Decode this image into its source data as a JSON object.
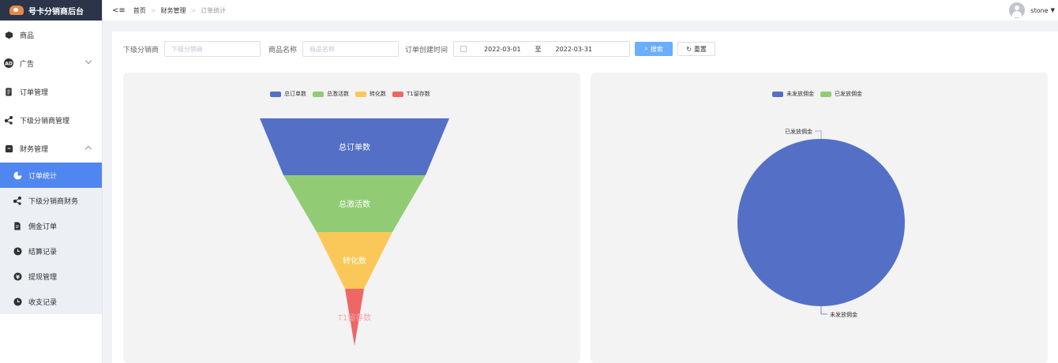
{
  "app": {
    "title": "号卡分销商后台"
  },
  "sidebar": {
    "items": [
      {
        "label": "商品",
        "icon": "box-icon"
      },
      {
        "label": "广告",
        "icon": "ad-icon"
      },
      {
        "label": "订单管理",
        "icon": "document-icon"
      },
      {
        "label": "下级分销商管理",
        "icon": "share-icon"
      },
      {
        "label": "财务管理",
        "icon": "wallet-icon"
      }
    ],
    "finance_sub": [
      {
        "label": "订单统计",
        "icon": "pie-icon"
      },
      {
        "label": "下级分销商财务",
        "icon": "share-icon"
      },
      {
        "label": "佣金订单",
        "icon": "file-icon"
      },
      {
        "label": "结算记录",
        "icon": "clock-icon"
      },
      {
        "label": "提现管理",
        "icon": "yen-icon"
      },
      {
        "label": "收支记录",
        "icon": "clock-icon"
      }
    ]
  },
  "breadcrumb": {
    "home": "首页",
    "section": "财务管理",
    "page": "订单统计"
  },
  "user": {
    "name": "stone"
  },
  "filters": {
    "distributor_label": "下级分销商",
    "distributor_placeholder": "下级分销商",
    "product_label": "商品名称",
    "product_placeholder": "商品名称",
    "time_label": "订单创建时间",
    "start_date": "2022-03-01",
    "range_sep": "至",
    "end_date": "2022-03-31",
    "search_button": "搜索",
    "reset_button": "重置"
  },
  "colors": {
    "blue": "#5470c6",
    "green": "#91cc75",
    "yellow": "#fac858",
    "red": "#ee6666",
    "active": "#4f86f0"
  },
  "chart_data": [
    {
      "type": "funnel",
      "legend": [
        "总订单数",
        "总激活数",
        "转化数",
        "T1留存数"
      ],
      "categories": [
        "总订单数",
        "总激活数",
        "转化数",
        "T1留存数"
      ],
      "values": [
        100,
        75,
        40,
        10
      ]
    },
    {
      "type": "pie",
      "legend": [
        "未发放佣金",
        "已发放佣金"
      ],
      "categories": [
        "未发放佣金",
        "已发放佣金"
      ],
      "values": [
        100,
        0
      ],
      "annotations": [
        "已发放佣金",
        "未发放佣金"
      ]
    }
  ]
}
